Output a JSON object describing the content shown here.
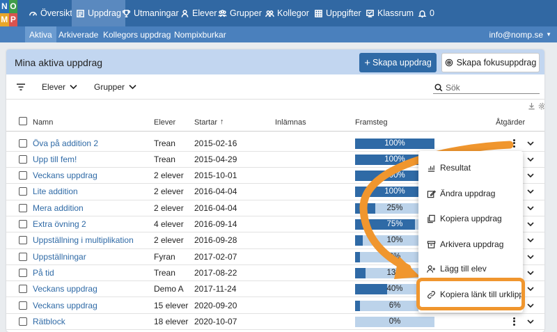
{
  "logo": {
    "letters": [
      "N",
      "O",
      "M",
      "P"
    ],
    "colors": [
      "#2d6fb6",
      "#3f9c4a",
      "#e8a62a",
      "#d9534f"
    ]
  },
  "nav": {
    "items": [
      {
        "label": "Översikt",
        "icon": "dashboard-icon"
      },
      {
        "label": "Uppdrag",
        "icon": "assignment-icon",
        "active": true
      },
      {
        "label": "Utmaningar",
        "icon": "trophy-icon"
      },
      {
        "label": "Elever",
        "icon": "user-icon"
      },
      {
        "label": "Grupper",
        "icon": "users-icon"
      },
      {
        "label": "Kollegor",
        "icon": "colleagues-icon"
      },
      {
        "label": "Uppgifter",
        "icon": "grid-icon"
      },
      {
        "label": "Klassrum",
        "icon": "classroom-icon"
      }
    ],
    "notifications": "0"
  },
  "subnav": {
    "items": [
      "Aktiva",
      "Arkiverade",
      "Kollegors uppdrag",
      "Nompixburkar"
    ],
    "active": "Aktiva",
    "user_email": "info@nomp.se"
  },
  "card": {
    "title": "Mina aktiva uppdrag",
    "create_button": "Skapa uppdrag",
    "focus_button": "Skapa fokusuppdrag"
  },
  "filters": {
    "students": "Elever",
    "groups": "Grupper",
    "search_placeholder": "Sök"
  },
  "table": {
    "columns": [
      "Namn",
      "Elever",
      "Startar",
      "Inlämnas",
      "Framsteg",
      "Åtgärder"
    ],
    "rows": [
      {
        "name": "Öva på addition 2",
        "students": "Trean",
        "start": "2015-02-16",
        "progress": 100,
        "label": "100%"
      },
      {
        "name": "Upp till fem!",
        "students": "Trean",
        "start": "2015-04-29",
        "progress": 100,
        "label": "100%"
      },
      {
        "name": "Veckans uppdrag",
        "students": "2 elever",
        "start": "2015-10-01",
        "progress": 100,
        "label": "100%"
      },
      {
        "name": "Lite addition",
        "students": "2 elever",
        "start": "2016-04-04",
        "progress": 100,
        "label": "100%"
      },
      {
        "name": "Mera addition",
        "students": "2 elever",
        "start": "2016-04-04",
        "progress": 25,
        "label": "25%"
      },
      {
        "name": "Extra övning 2",
        "students": "4 elever",
        "start": "2016-09-14",
        "progress": 75,
        "label": "75%"
      },
      {
        "name": "Uppställning i multiplikation",
        "students": "2 elever",
        "start": "2016-09-28",
        "progress": 10,
        "label": "10%"
      },
      {
        "name": "Uppställningar",
        "students": "Fyran",
        "start": "2017-02-07",
        "progress": 6,
        "label": "6%"
      },
      {
        "name": "På tid",
        "students": "Trean",
        "start": "2017-08-22",
        "progress": 13,
        "label": "13%"
      },
      {
        "name": "Veckans uppdrag",
        "students": "Demo A",
        "start": "2017-11-24",
        "progress": 40,
        "label": "40%"
      },
      {
        "name": "Veckans uppdrag",
        "students": "15 elever",
        "start": "2020-09-20",
        "progress": 6,
        "label": "6%"
      },
      {
        "name": "Rätblock",
        "students": "18 elever",
        "start": "2020-10-07",
        "progress": 0,
        "label": "0%"
      }
    ]
  },
  "menu": {
    "items": [
      {
        "label": "Resultat",
        "icon": "chart-icon"
      },
      {
        "label": "Ändra uppdrag",
        "icon": "edit-icon"
      },
      {
        "label": "Kopiera uppdrag",
        "icon": "copy-icon"
      },
      {
        "label": "Arkivera uppdrag",
        "icon": "archive-icon"
      },
      {
        "label": "Lägg till elev",
        "icon": "add-user-icon"
      },
      {
        "label": "Kopiera länk till urklipp",
        "icon": "link-icon"
      }
    ]
  },
  "colors": {
    "nav": "#3168a3",
    "subnav": "#4a80bd",
    "accent": "#2f6aa6",
    "highlight": "#f0962e"
  }
}
